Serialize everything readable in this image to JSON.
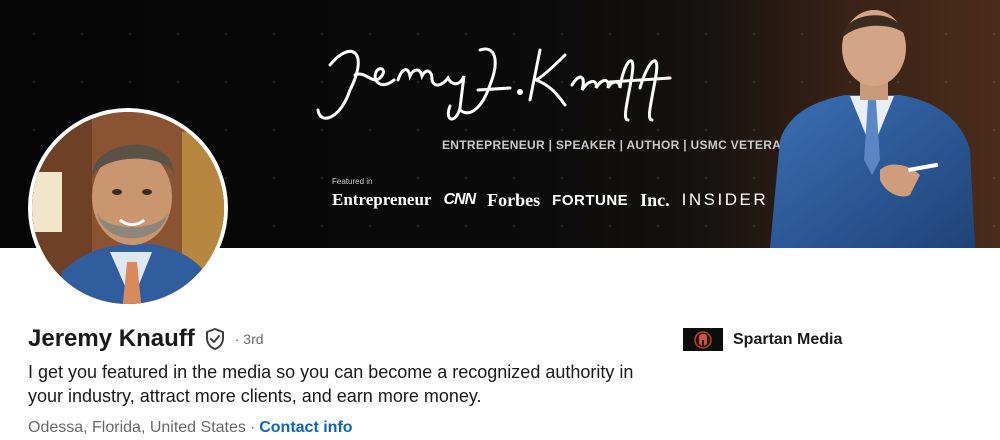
{
  "banner": {
    "signature_text": "Jeremy L. Knauff",
    "roles_text": "ENTREPRENEUR | SPEAKER | AUTHOR | USMC VETERAN",
    "featured_in_label": "Featured in",
    "media_logos": [
      "Entrepreneur",
      "CNN",
      "Forbes",
      "FORTUNE",
      "Inc.",
      "INSIDER"
    ]
  },
  "profile": {
    "name": "Jeremy Knauff",
    "connection_degree": "· 3rd",
    "headline": "I get you featured in the media so you can become a recognized authority in your industry, attract more clients, and earn more money.",
    "location": "Odessa, Florida, United States",
    "separator": "·",
    "contact_info_label": "Contact info"
  },
  "company": {
    "name": "Spartan Media"
  },
  "colors": {
    "link": "#0a66c2",
    "banner_dark": "#050505",
    "banner_warm": "#4a2c1a",
    "suit_blue": "#2f5d9e"
  }
}
